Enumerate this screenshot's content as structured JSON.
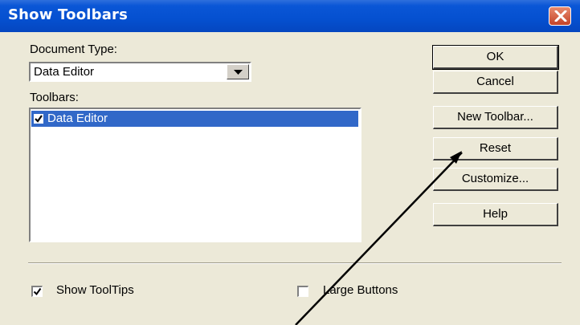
{
  "window": {
    "title": "Show Toolbars"
  },
  "document_type": {
    "label": "Document Type:",
    "selected": "Data Editor"
  },
  "toolbars": {
    "label": "Toolbars:",
    "items": [
      {
        "label": "Data Editor",
        "checked": true,
        "selected": true
      }
    ]
  },
  "buttons": {
    "ok": "OK",
    "cancel": "Cancel",
    "new_toolbar": "New Toolbar...",
    "reset": "Reset",
    "customize": "Customize...",
    "help": "Help"
  },
  "options": {
    "show_tooltips": {
      "label": "Show ToolTips",
      "checked": true
    },
    "large_buttons": {
      "label": "Large Buttons",
      "checked": false
    }
  },
  "icons": {
    "close": "close-icon",
    "dropdown": "chevron-down-icon",
    "check": "check-icon"
  },
  "colors": {
    "titlebar": "#0550d0",
    "selection": "#3168c8",
    "dialog_bg": "#ece9d8",
    "close_button": "#c44328"
  }
}
